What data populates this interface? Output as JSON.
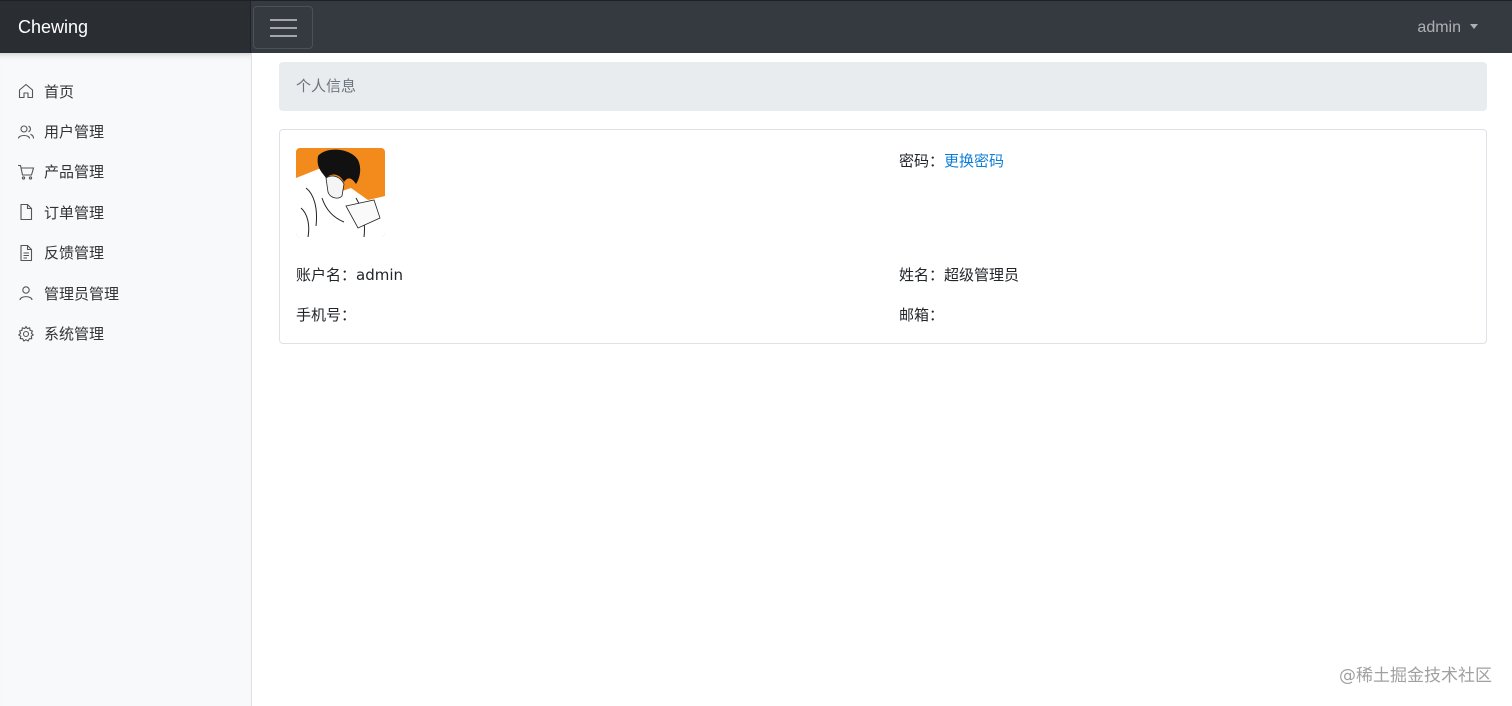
{
  "header": {
    "brand": "Chewing",
    "user": "admin"
  },
  "sidebar": {
    "items": [
      {
        "label": "首页",
        "icon": "home-icon"
      },
      {
        "label": "用户管理",
        "icon": "users-icon"
      },
      {
        "label": "产品管理",
        "icon": "cart-icon"
      },
      {
        "label": "订单管理",
        "icon": "file-icon"
      },
      {
        "label": "反馈管理",
        "icon": "document-text-icon"
      },
      {
        "label": "管理员管理",
        "icon": "user-icon"
      },
      {
        "label": "系统管理",
        "icon": "gear-icon"
      }
    ]
  },
  "breadcrumb": "个人信息",
  "profile": {
    "account_label": "账户名：",
    "account_value": "admin",
    "phone_label": "手机号：",
    "phone_value": "",
    "password_label": "密码：",
    "password_link": "更换密码",
    "name_label": "姓名：",
    "name_value": "超级管理员",
    "email_label": "邮箱：",
    "email_value": ""
  },
  "watermark": "@稀土掘金技术社区",
  "colors": {
    "topbar": "#343a40",
    "brand_bg": "#2a2e33",
    "sidebar_bg": "#f8f9fa",
    "breadcrumb_bg": "#e9ecef",
    "link": "#0d7fd8",
    "avatar_bg": "#f28a1c"
  }
}
